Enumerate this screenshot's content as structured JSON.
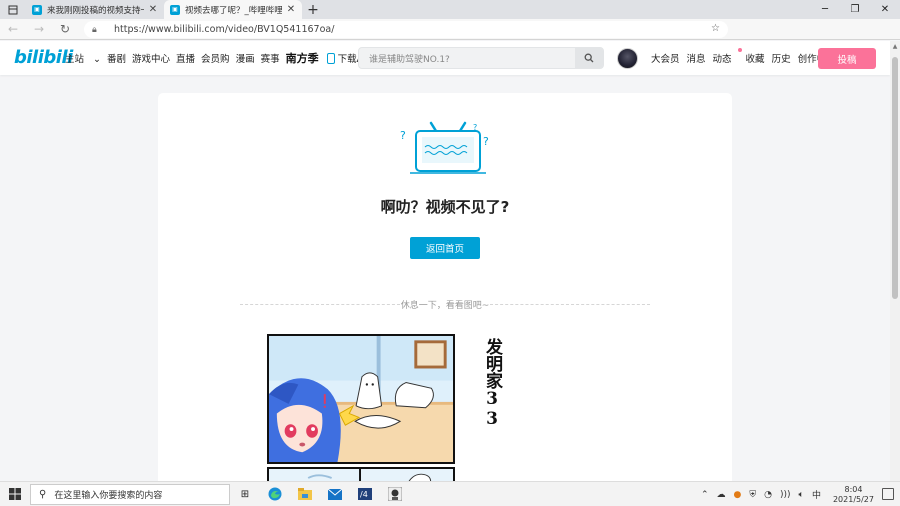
{
  "browser": {
    "tabs": [
      {
        "title": "来我刚刚投稿的视频支持一波 - 哔哩哔哩",
        "active": false,
        "fav_color": "#00a1d6"
      },
      {
        "title": "视频去哪了呢？_哔哩哔哩 (゜-゜)つロ",
        "active": true,
        "fav_color": "#00a1d6"
      }
    ],
    "new_tab_label": "+",
    "url": "https://www.bilibili.com/video/BV1Q541167oa/"
  },
  "header": {
    "logo": "bilibili",
    "nav": [
      "主站",
      "番剧",
      "游戏中心",
      "直播",
      "会员购",
      "漫画",
      "赛事"
    ],
    "special": "南方季",
    "app_label": "下载APP",
    "search_placeholder": "谁是辅助驾驶NO.1?",
    "user_items": [
      "大会员",
      "消息",
      "动态",
      "收藏",
      "历史",
      "创作中心"
    ],
    "upload_label": "投稿",
    "brand_color": "#00a1d6",
    "accent_color": "#fb7299"
  },
  "error": {
    "title": "啊叻？视频不见了?",
    "home_button": "返回首页",
    "divider_text": "休息一下，看看图吧~",
    "comic_caption": "发明家33"
  },
  "taskbar": {
    "search_placeholder": "在这里输入你要搜索的内容",
    "ime": "中",
    "time": "8:04",
    "date": "2021/5/27"
  }
}
